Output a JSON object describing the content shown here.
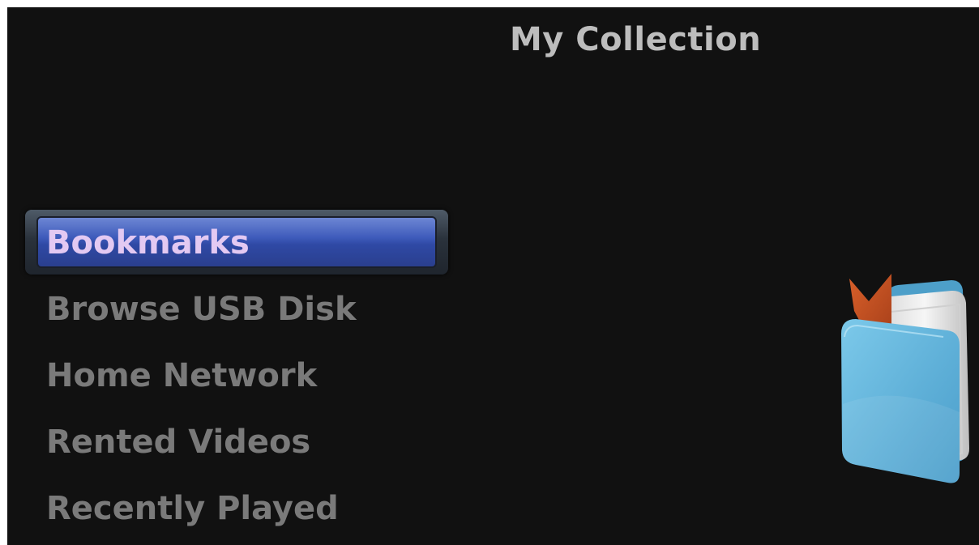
{
  "header": {
    "title": "My Collection"
  },
  "menu": {
    "items": [
      {
        "label": "Bookmarks",
        "selected": true
      },
      {
        "label": "Browse USB Disk",
        "selected": false
      },
      {
        "label": "Home Network",
        "selected": false
      },
      {
        "label": "Rented Videos",
        "selected": false
      },
      {
        "label": "Recently Played",
        "selected": false
      }
    ]
  },
  "illustration": {
    "icon": "book-with-bookmark-icon"
  },
  "colors": {
    "background": "#111111",
    "title": "#bdbdbd",
    "menu_text": "#7a7a7a",
    "selected_text": "#e3c9f2",
    "selection_bar": "#3f5cbc",
    "book_cover": "#62b4d9",
    "bookmark_ribbon": "#c64f20"
  }
}
